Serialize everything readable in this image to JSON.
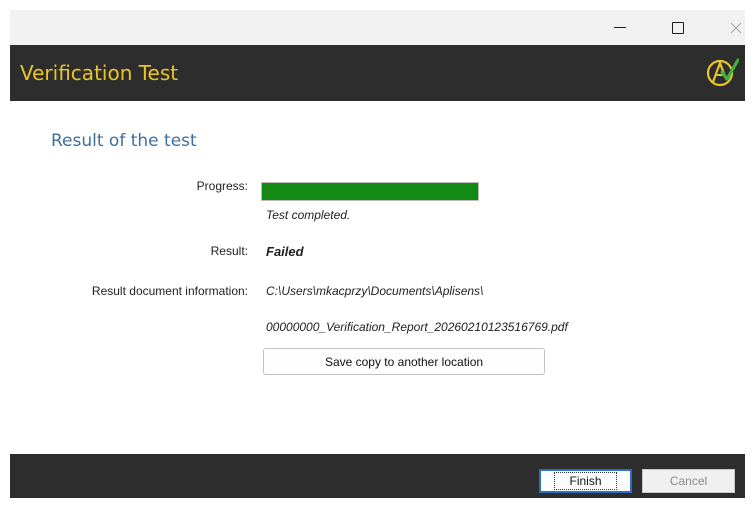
{
  "window": {
    "title": "Verification Test",
    "controls": {
      "minimize": "minimize-icon",
      "maximize": "maximize-icon",
      "close": "close-icon"
    }
  },
  "main": {
    "section_title": "Result of the test",
    "progress": {
      "label": "Progress:",
      "value": 1.0,
      "color": "#138a13",
      "status": "Test completed."
    },
    "result": {
      "label": "Result:",
      "value": "Failed"
    },
    "document": {
      "label": "Result document information:",
      "path": "C:\\Users\\mkacprzy\\Documents\\Aplisens\\",
      "filename": "00000000_Verification_Report_20260210123516769.pdf"
    },
    "save_button": "Save copy to another location"
  },
  "footer": {
    "finish_label": "Finish",
    "cancel_label": "Cancel"
  },
  "colors": {
    "header_bg": "#2d2d2d",
    "title_text": "#e8c628",
    "section_title": "#3f6f9e",
    "focus_border": "#2b6fc4"
  }
}
